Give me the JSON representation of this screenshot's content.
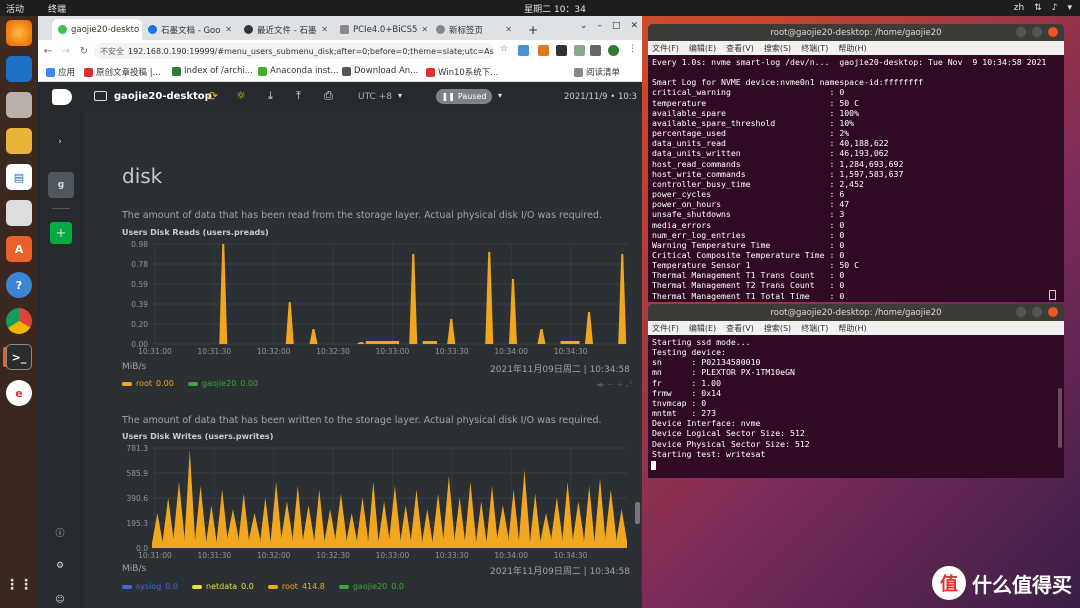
{
  "topbar": {
    "activities": "活动",
    "app": "终端",
    "clock": "星期二 10：34",
    "lang": "zh",
    "tray": "▾"
  },
  "browser": {
    "tabs": [
      {
        "label": "gaojie20-deskto",
        "color": "#37c24a"
      },
      {
        "label": "石墨文档 - Goo",
        "color": "#1a73e8"
      },
      {
        "label": "最近文件 - 石墨",
        "color": "#333333"
      },
      {
        "label": "PCIe4.0+BiCS5",
        "color": "#888888"
      },
      {
        "label": "新标签页",
        "color": "#888888"
      }
    ],
    "url_warn": "不安全",
    "url": "192.168.0.190:19999/#menu_users_submenu_disk;after=0;before=0;theme=slate;utc=Asia/S...",
    "bookmarks": [
      {
        "label": "应用",
        "color": "#4285f4"
      },
      {
        "label": "原创文章投稿 |...",
        "color": "#e03030"
      },
      {
        "label": "Index of /archi...",
        "color": "#2e7d32"
      },
      {
        "label": "Anaconda inst...",
        "color": "#43b02a"
      },
      {
        "label": "Download An...",
        "color": "#555555"
      },
      {
        "label": "Win10系统下...",
        "color": "#e03030"
      },
      {
        "label": "阅读清单",
        "color": "#888888"
      }
    ]
  },
  "netdata": {
    "hostname": "gaojie20-desktop",
    "utc": "UTC +8",
    "paused": "Paused",
    "date": "2021/11/9 • 10:3",
    "sidebar_letter": "g",
    "section": "disk",
    "reads": {
      "desc": "The amount of data that has been read from the storage layer. Actual physical disk I/O was required.",
      "title": "Users Disk Reads (users.preads)",
      "units": "MiB/s",
      "stamp": "2021年11月09日周二 | 10:34:58",
      "yticks": [
        "0.98",
        "0.78",
        "0.59",
        "0.39",
        "0.20",
        "0.00"
      ],
      "xticks": [
        "10:31:00",
        "10:31:30",
        "10:32:00",
        "10:32:30",
        "10:33:00",
        "10:33:30",
        "10:34:00",
        "10:34:30"
      ],
      "legend": [
        {
          "name": "root",
          "value": "0.00",
          "color": "#f0a71f"
        },
        {
          "name": "gaojie20",
          "value": "0.00",
          "color": "#3aa637"
        }
      ]
    },
    "writes": {
      "desc": "The amount of data that has been written to the storage layer. Actual physical disk I/O was required.",
      "title": "Users Disk Writes (users.pwrites)",
      "units": "MiB/s",
      "stamp": "2021年11月09日周二 | 10:34:58",
      "yticks": [
        "781.3",
        "585.9",
        "390.6",
        "195.3",
        "0.0"
      ],
      "xticks": [
        "10:31:00",
        "10:31:30",
        "10:32:00",
        "10:32:30",
        "10:33:00",
        "10:33:30",
        "10:34:00",
        "10:34:30"
      ],
      "legend": [
        {
          "name": "syslog",
          "value": "0.0",
          "color": "#3b6bd6"
        },
        {
          "name": "netdata",
          "value": "0.0",
          "color": "#e8e03a"
        },
        {
          "name": "root",
          "value": "414.8",
          "color": "#f0a71f"
        },
        {
          "name": "gaojie20",
          "value": "0.0",
          "color": "#3aa637"
        }
      ]
    }
  },
  "term1": {
    "title": "root@gaojie20-desktop: /home/gaojie20",
    "menu": [
      "文件(F)",
      "编辑(E)",
      "查看(V)",
      "搜索(S)",
      "终端(T)",
      "帮助(H)"
    ],
    "lines": [
      "Every 1.0s: nvme smart-log /dev/n...  gaojie20-desktop: Tue Nov  9 10:34:58 2021",
      "",
      "Smart Log for NVME device:nvme0n1 namespace-id:ffffffff",
      "critical_warning                    : 0",
      "temperature                         : 50 C",
      "available_spare                     : 100%",
      "available_spare_threshold           : 10%",
      "percentage_used                     : 2%",
      "data_units_read                     : 40,188,622",
      "data_units_written                  : 46,193,062",
      "host_read_commands                  : 1,284,693,692",
      "host_write_commands                 : 1,597,583,637",
      "controller_busy_time                : 2,452",
      "power_cycles                        : 6",
      "power_on_hours                      : 47",
      "unsafe_shutdowns                    : 3",
      "media_errors                        : 0",
      "num_err_log_entries                 : 0",
      "Warning Temperature Time            : 0",
      "Critical Composite Temperature Time : 0",
      "Temperature Sensor 1                : 50 C",
      "Thermal Management T1 Trans Count   : 0",
      "Thermal Management T2 Trans Count   : 0",
      "Thermal Management T1 Total Time    : 0"
    ]
  },
  "term2": {
    "title": "root@gaojie20-desktop: /home/gaojie20",
    "lines": [
      "Starting ssd mode...",
      "Testing device:",
      "sn      : P02134580010",
      "mn      : PLEXTOR PX-1TM10eGN",
      "fr      : 1.00",
      "frmw    : 0x14",
      "tnvmcap : 0",
      "mntmt   : 273",
      "Device Interface: nvme",
      "Device Logical Sector Size: 512",
      "Device Physical Sector Size: 512",
      "Starting test: writesat"
    ]
  },
  "watermark": {
    "logo": "值",
    "text": "什么值得买"
  },
  "chart_data": [
    {
      "type": "area",
      "title": "Users Disk Reads (users.preads)",
      "ylabel": "MiB/s",
      "ylim": [
        0,
        0.98
      ],
      "x": [
        "10:31:00",
        "10:31:30",
        "10:32:00",
        "10:32:30",
        "10:33:00",
        "10:33:30",
        "10:34:00",
        "10:34:30"
      ],
      "series": [
        {
          "name": "root",
          "color": "#f0a71f",
          "peaks": [
            [
              0.15,
              1.0
            ],
            [
              0.29,
              0.42
            ],
            [
              0.34,
              0.15
            ],
            [
              0.44,
              0.02
            ],
            [
              0.55,
              0.9
            ],
            [
              0.63,
              0.25
            ],
            [
              0.71,
              0.92
            ],
            [
              0.76,
              0.65
            ],
            [
              0.82,
              0.15
            ],
            [
              0.92,
              0.32
            ],
            [
              0.99,
              0.9
            ]
          ]
        }
      ]
    },
    {
      "type": "area",
      "title": "Users Disk Writes (users.pwrites)",
      "ylabel": "MiB/s",
      "ylim": [
        0,
        781.3
      ],
      "x": [
        "10:31:00",
        "10:31:30",
        "10:32:00",
        "10:32:30",
        "10:33:00",
        "10:33:30",
        "10:34:00",
        "10:34:30"
      ],
      "series": [
        {
          "name": "root",
          "color": "#f0a71f",
          "last": 414.8
        }
      ]
    }
  ]
}
